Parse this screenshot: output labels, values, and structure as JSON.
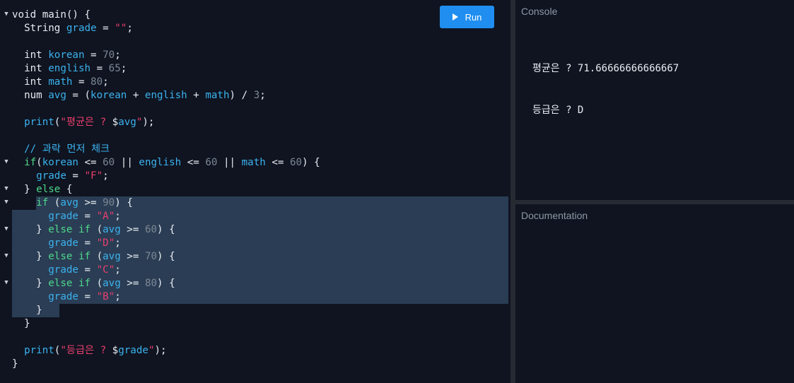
{
  "toolbar": {
    "run_label": "Run"
  },
  "panes": {
    "console_title": "Console",
    "docs_title": "Documentation"
  },
  "console": {
    "lines": [
      "평균은 ? 71.66666666666667",
      "등급은 ? D"
    ]
  },
  "editor": {
    "lines": [
      {
        "fold": true,
        "tokens": [
          [
            "kw",
            "void "
          ],
          [
            "pun",
            "main() {"
          ]
        ]
      },
      {
        "fold": false,
        "tokens": [
          [
            "pun",
            "  String "
          ],
          [
            "var",
            "grade"
          ],
          [
            "pun",
            " = "
          ],
          [
            "str",
            "\"\""
          ],
          [
            "pun",
            ";"
          ]
        ]
      },
      {
        "fold": false,
        "tokens": []
      },
      {
        "fold": false,
        "tokens": [
          [
            "pun",
            "  int "
          ],
          [
            "var",
            "korean"
          ],
          [
            "pun",
            " = "
          ],
          [
            "num",
            "70"
          ],
          [
            "pun",
            ";"
          ]
        ]
      },
      {
        "fold": false,
        "tokens": [
          [
            "pun",
            "  int "
          ],
          [
            "var",
            "english"
          ],
          [
            "pun",
            " = "
          ],
          [
            "num",
            "65"
          ],
          [
            "pun",
            ";"
          ]
        ]
      },
      {
        "fold": false,
        "tokens": [
          [
            "pun",
            "  int "
          ],
          [
            "var",
            "math"
          ],
          [
            "pun",
            " = "
          ],
          [
            "num",
            "80"
          ],
          [
            "pun",
            ";"
          ]
        ]
      },
      {
        "fold": false,
        "tokens": [
          [
            "pun",
            "  num "
          ],
          [
            "var",
            "avg"
          ],
          [
            "pun",
            " = ("
          ],
          [
            "var",
            "korean"
          ],
          [
            "pun",
            " + "
          ],
          [
            "var",
            "english"
          ],
          [
            "pun",
            " + "
          ],
          [
            "var",
            "math"
          ],
          [
            "pun",
            ") / "
          ],
          [
            "num",
            "3"
          ],
          [
            "pun",
            ";"
          ]
        ]
      },
      {
        "fold": false,
        "tokens": []
      },
      {
        "fold": false,
        "tokens": [
          [
            "fn",
            "  print"
          ],
          [
            "pun",
            "("
          ],
          [
            "str",
            "\"평균은 ? "
          ],
          [
            "pun",
            "$"
          ],
          [
            "var",
            "avg"
          ],
          [
            "str",
            "\""
          ],
          [
            "pun",
            ");"
          ]
        ]
      },
      {
        "fold": false,
        "tokens": []
      },
      {
        "fold": false,
        "tokens": [
          [
            "cmt",
            "  // 과락 먼저 체크"
          ]
        ]
      },
      {
        "fold": true,
        "tokens": [
          [
            "ctl",
            "  if"
          ],
          [
            "pun",
            "("
          ],
          [
            "var",
            "korean"
          ],
          [
            "pun",
            " <= "
          ],
          [
            "num",
            "60"
          ],
          [
            "pun",
            " || "
          ],
          [
            "var",
            "english"
          ],
          [
            "pun",
            " <= "
          ],
          [
            "num",
            "60"
          ],
          [
            "pun",
            " || "
          ],
          [
            "var",
            "math"
          ],
          [
            "pun",
            " <= "
          ],
          [
            "num",
            "60"
          ],
          [
            "pun",
            ") {"
          ]
        ]
      },
      {
        "fold": false,
        "tokens": [
          [
            "var",
            "    grade"
          ],
          [
            "pun",
            " = "
          ],
          [
            "str",
            "\"F\""
          ],
          [
            "pun",
            ";"
          ]
        ]
      },
      {
        "fold": true,
        "tokens": [
          [
            "pun",
            "  } "
          ],
          [
            "ctl",
            "else"
          ],
          [
            "pun",
            " {"
          ]
        ]
      },
      {
        "fold": true,
        "tokens": [
          [
            "ctl",
            "    if"
          ],
          [
            "pun",
            " ("
          ],
          [
            "var",
            "avg"
          ],
          [
            "pun",
            " >= "
          ],
          [
            "num",
            "90"
          ],
          [
            "pun",
            ") {"
          ]
        ]
      },
      {
        "fold": false,
        "tokens": [
          [
            "var",
            "      grade"
          ],
          [
            "pun",
            " = "
          ],
          [
            "str",
            "\"A\""
          ],
          [
            "pun",
            ";"
          ]
        ]
      },
      {
        "fold": true,
        "tokens": [
          [
            "pun",
            "    } "
          ],
          [
            "ctl",
            "else if"
          ],
          [
            "pun",
            " ("
          ],
          [
            "var",
            "avg"
          ],
          [
            "pun",
            " >= "
          ],
          [
            "num",
            "60"
          ],
          [
            "pun",
            ") {"
          ]
        ]
      },
      {
        "fold": false,
        "tokens": [
          [
            "var",
            "      grade"
          ],
          [
            "pun",
            " = "
          ],
          [
            "str",
            "\"D\""
          ],
          [
            "pun",
            ";"
          ]
        ]
      },
      {
        "fold": true,
        "tokens": [
          [
            "pun",
            "    } "
          ],
          [
            "ctl",
            "else if"
          ],
          [
            "pun",
            " ("
          ],
          [
            "var",
            "avg"
          ],
          [
            "pun",
            " >= "
          ],
          [
            "num",
            "70"
          ],
          [
            "pun",
            ") {"
          ]
        ]
      },
      {
        "fold": false,
        "tokens": [
          [
            "var",
            "      grade"
          ],
          [
            "pun",
            " = "
          ],
          [
            "str",
            "\"C\""
          ],
          [
            "pun",
            ";"
          ]
        ]
      },
      {
        "fold": true,
        "tokens": [
          [
            "pun",
            "    } "
          ],
          [
            "ctl",
            "else if"
          ],
          [
            "pun",
            " ("
          ],
          [
            "var",
            "avg"
          ],
          [
            "pun",
            " >= "
          ],
          [
            "num",
            "80"
          ],
          [
            "pun",
            ") {"
          ]
        ]
      },
      {
        "fold": false,
        "tokens": [
          [
            "var",
            "      grade"
          ],
          [
            "pun",
            " = "
          ],
          [
            "str",
            "\"B\""
          ],
          [
            "pun",
            ";"
          ]
        ]
      },
      {
        "fold": false,
        "tokens": [
          [
            "pun",
            "    }"
          ]
        ]
      },
      {
        "fold": false,
        "tokens": [
          [
            "pun",
            "  }"
          ]
        ]
      },
      {
        "fold": false,
        "tokens": []
      },
      {
        "fold": false,
        "tokens": [
          [
            "fn",
            "  print"
          ],
          [
            "pun",
            "("
          ],
          [
            "str",
            "\"등급은 ? "
          ],
          [
            "pun",
            "$"
          ],
          [
            "var",
            "grade"
          ],
          [
            "str",
            "\""
          ],
          [
            "pun",
            ");"
          ]
        ]
      },
      {
        "fold": false,
        "tokens": [
          [
            "pun",
            "}"
          ]
        ]
      }
    ]
  },
  "colors": {
    "accent": "#1f8ef0",
    "selection": "#2a3d54",
    "string": "#ea3e6e",
    "identifier": "#3cb2ee",
    "keyword_control": "#4ed78a"
  }
}
